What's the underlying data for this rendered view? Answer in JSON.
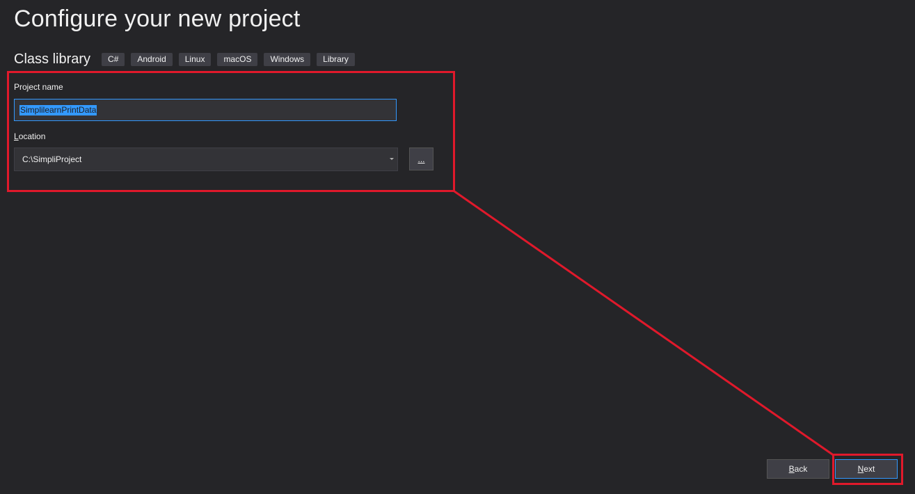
{
  "header": {
    "title": "Configure your new project"
  },
  "template": {
    "name": "Class library",
    "tags": [
      "C#",
      "Android",
      "Linux",
      "macOS",
      "Windows",
      "Library"
    ]
  },
  "form": {
    "project_name": {
      "label": "Project name",
      "value": "SimplilearnPrintData"
    },
    "location": {
      "label_access_key": "L",
      "label_rest": "ocation",
      "value": "C:\\SimpliProject",
      "browse_label": "..."
    }
  },
  "footer": {
    "back_access_key": "B",
    "back_rest": "ack",
    "next_access_key": "N",
    "next_rest": "ext"
  },
  "colors": {
    "background": "#252528",
    "annotation": "#e0192b",
    "accent": "#3399ff"
  }
}
